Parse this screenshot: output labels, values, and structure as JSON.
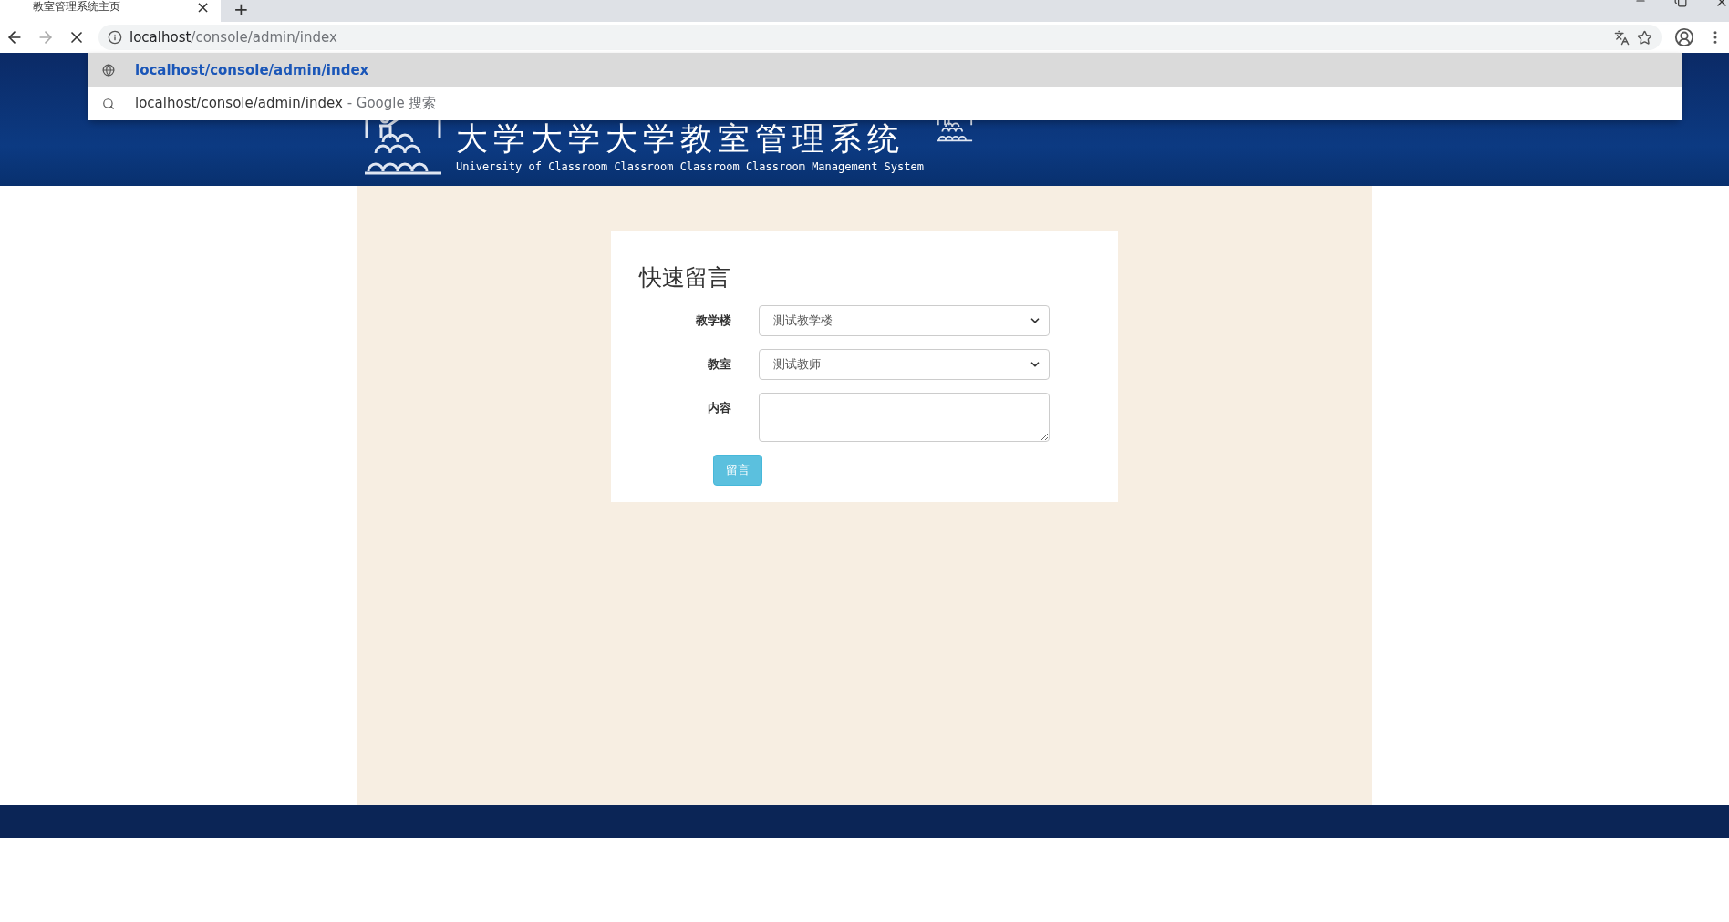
{
  "browser": {
    "tab": {
      "title": "教室管理系统主页",
      "close": "×"
    },
    "new_tab": "+",
    "loading": true,
    "address": {
      "host": "localhost",
      "path": "/console/admin/index"
    },
    "suggestions": [
      {
        "kind": "url",
        "text": "localhost/console/admin/index",
        "selected": true
      },
      {
        "kind": "search",
        "text": "localhost/console/admin/index",
        "suffix": "- Google 搜索",
        "selected": false
      }
    ]
  },
  "header": {
    "title": "大学大学大学教室管理系统",
    "subtitle": "University of Classroom Classroom Classroom Classroom Management System"
  },
  "form": {
    "title": "快速留言",
    "fields": [
      {
        "kind": "select",
        "label": "教学楼",
        "value": "测试教学楼"
      },
      {
        "kind": "select",
        "label": "教室",
        "value": "测试教师"
      },
      {
        "kind": "textarea",
        "label": "内容"
      }
    ],
    "submit": "留言"
  }
}
